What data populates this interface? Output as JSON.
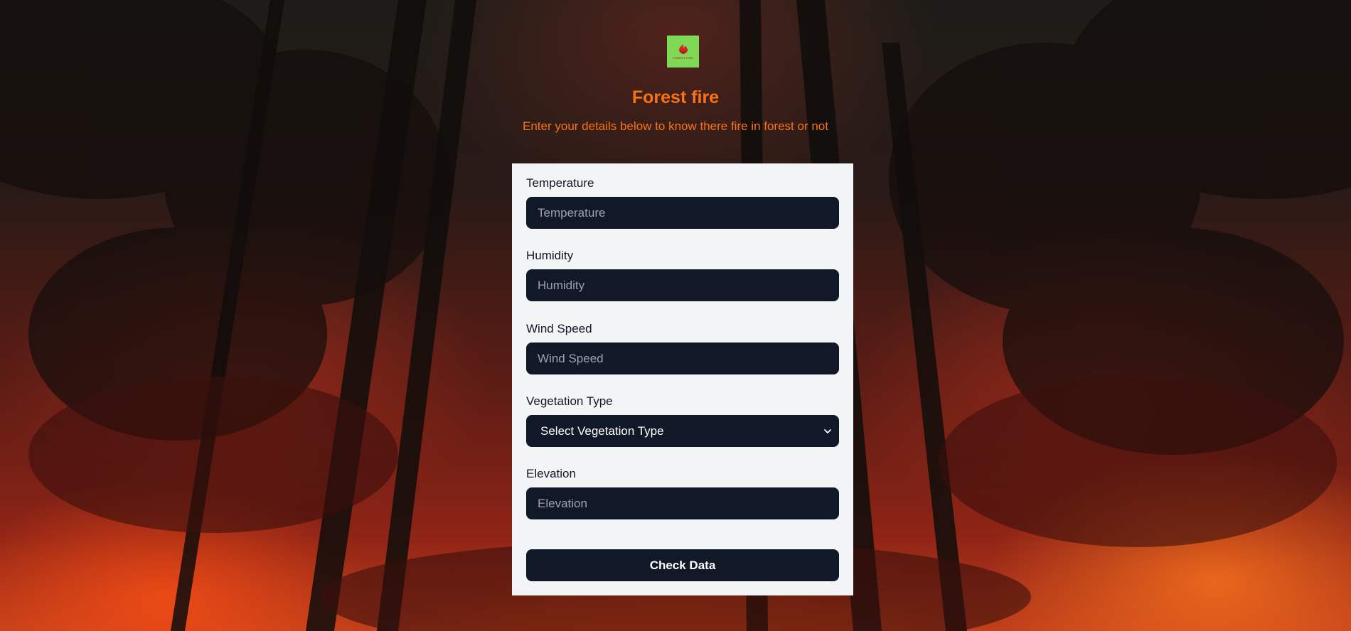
{
  "app": {
    "title": "Forest fire",
    "subtitle": "Enter your details below to know there fire in forest or not",
    "logo_text": "FOREST FIRE"
  },
  "form": {
    "fields": [
      {
        "label": "Temperature",
        "placeholder": "Temperature",
        "value": ""
      },
      {
        "label": "Humidity",
        "placeholder": "Humidity",
        "value": ""
      },
      {
        "label": "Wind Speed",
        "placeholder": "Wind Speed",
        "value": ""
      },
      {
        "label": "Vegetation Type",
        "selected": "Select Vegetation Type"
      },
      {
        "label": "Elevation",
        "placeholder": "Elevation",
        "value": ""
      }
    ],
    "submit_label": "Check Data"
  },
  "colors": {
    "accent": "#f97316",
    "input_bg": "#111827",
    "card_bg": "#f3f4f6",
    "logo_bg": "#7ed957"
  },
  "icons": {
    "logo": "flame-logo-icon",
    "select_caret": "chevron-down-icon"
  }
}
